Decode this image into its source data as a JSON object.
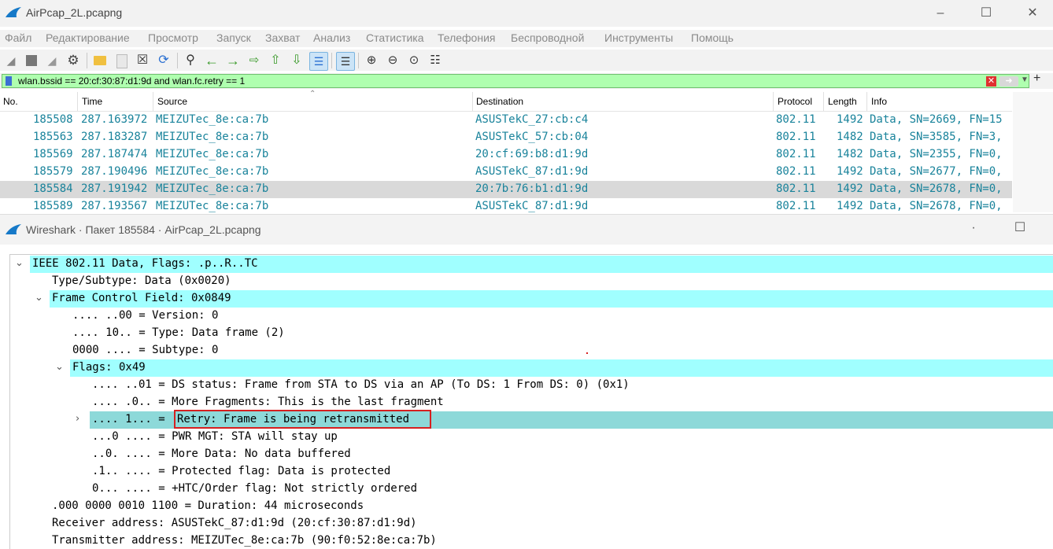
{
  "window": {
    "title": "AirPcap_2L.pcapng"
  },
  "menu": [
    "Файл",
    "Редактирование",
    "Просмотр",
    "Запуск",
    "Захват",
    "Анализ",
    "Статистика",
    "Телефония",
    "Беспроводной",
    "Инструменты",
    "Помощь"
  ],
  "filter": {
    "value": "wlan.bssid == 20:cf:30:87:d1:9d and wlan.fc.retry == 1"
  },
  "packet_list": {
    "columns": [
      "No.",
      "Time",
      "Source",
      "Destination",
      "Protocol",
      "Length",
      "Info"
    ],
    "rows": [
      [
        "185508",
        "287.163972",
        "MEIZUTec_8e:ca:7b",
        "ASUSTekC_27:cb:c4",
        "802.11",
        "1492",
        "Data, SN=2669, FN=15"
      ],
      [
        "185563",
        "287.183287",
        "MEIZUTec_8e:ca:7b",
        "ASUSTekC_57:cb:04",
        "802.11",
        "1482",
        "Data, SN=3585, FN=3,"
      ],
      [
        "185569",
        "287.187474",
        "MEIZUTec_8e:ca:7b",
        "20:cf:69:b8:d1:9d",
        "802.11",
        "1482",
        "Data, SN=2355, FN=0,"
      ],
      [
        "185579",
        "287.190496",
        "MEIZUTec_8e:ca:7b",
        "ASUSTekC_87:d1:9d",
        "802.11",
        "1492",
        "Data, SN=2677, FN=0,"
      ],
      [
        "185584",
        "287.191942",
        "MEIZUTec_8e:ca:7b",
        "20:7b:76:b1:d1:9d",
        "802.11",
        "1492",
        "Data, SN=2678, FN=0,"
      ],
      [
        "185589",
        "287.193567",
        "MEIZUTec_8e:ca:7b",
        "ASUSTekC_87:d1:9d",
        "802.11",
        "1492",
        "Data, SN=2678, FN=0,"
      ]
    ],
    "selected_row": 4
  },
  "packet_window": {
    "title": "Wireshark · Пакет 185584 · AirPcap_2L.pcapng"
  },
  "tree": {
    "r0": "IEEE 802.11 Data, Flags: .p..R..TC",
    "r1": "Type/Subtype: Data (0x0020)",
    "r2": "Frame Control Field: 0x0849",
    "r3": ".... ..00 = Version: 0",
    "r4": ".... 10.. = Type: Data frame (2)",
    "r5": "0000 .... = Subtype: 0",
    "r6": "Flags: 0x49",
    "r7": ".... ..01 = DS status: Frame from STA to DS via an AP (To DS: 1 From DS: 0) (0x1)",
    "r8": ".... .0.. = More Fragments: This is the last fragment",
    "r9a": ".... 1... = ",
    "r9b": "Retry: Frame is being retransmitted",
    "r10": "...0 .... = PWR MGT: STA will stay up",
    "r11": "..0. .... = More Data: No data buffered",
    "r12": ".1.. .... = Protected flag: Data is protected",
    "r13": "0... .... = +HTC/Order flag: Not strictly ordered",
    "r14": ".000 0000 0010 1100 = Duration: 44 microseconds",
    "r15": "Receiver address: ASUSTekC_87:d1:9d (20:cf:30:87:d1:9d)",
    "r16": "Transmitter address: MEIZUTec_8e:ca:7b (90:f0:52:8e:ca:7b)"
  }
}
